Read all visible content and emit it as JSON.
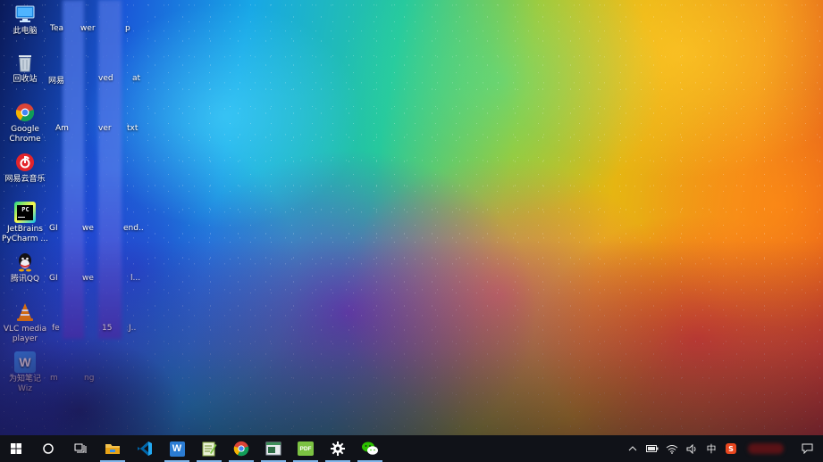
{
  "desktop_icons": [
    {
      "name": "this-pc",
      "label": "此电脑",
      "icon": "pc-icon"
    },
    {
      "name": "recycle-bin",
      "label": "回收站",
      "icon": "recycle-bin-icon"
    },
    {
      "name": "google-chrome",
      "label": "Google\nChrome",
      "icon": "chrome-icon"
    },
    {
      "name": "netease-music",
      "label": "网易云音乐",
      "icon": "netease-music-icon"
    },
    {
      "name": "pycharm",
      "label": "JetBrains\nPyCharm ...",
      "icon": "pycharm-icon"
    },
    {
      "name": "tencent-qq",
      "label": "腾讯QQ",
      "icon": "qq-icon"
    },
    {
      "name": "vlc",
      "label": "VLC media\nplayer",
      "icon": "vlc-icon"
    },
    {
      "name": "wiz-note",
      "label": "为知笔记\nWiz",
      "icon": "wiz-icon"
    }
  ],
  "obscured_fragments": [
    {
      "text": "Tea"
    },
    {
      "text": "wer"
    },
    {
      "text": "p"
    },
    {
      "text": "网易"
    },
    {
      "text": "ved"
    },
    {
      "text": "at"
    },
    {
      "text": "Am"
    },
    {
      "text": "ver"
    },
    {
      "text": "txt"
    },
    {
      "text": "GI"
    },
    {
      "text": "we"
    },
    {
      "text": "end.."
    },
    {
      "text": "GI"
    },
    {
      "text": "we"
    },
    {
      "text": "l..."
    },
    {
      "text": "fe"
    },
    {
      "text": "15"
    },
    {
      "text": "J.."
    },
    {
      "text": "m"
    },
    {
      "text": "ng"
    }
  ],
  "taskbar": {
    "start": "windows-start-icon",
    "search": "cortana-circle-icon",
    "task_view": "task-view-icon",
    "pinned": [
      {
        "name": "file-explorer",
        "icon": "folder-icon",
        "active": true
      },
      {
        "name": "vscode",
        "icon": "vscode-icon",
        "active": false
      },
      {
        "name": "word",
        "icon": "word-icon",
        "active": true
      },
      {
        "name": "notepad-plus",
        "icon": "notepad-icon",
        "active": true
      },
      {
        "name": "chrome",
        "icon": "chrome-icon",
        "active": true
      },
      {
        "name": "terminal",
        "icon": "terminal-icon",
        "active": true
      },
      {
        "name": "pdf",
        "icon": "pdf-icon",
        "active": true
      },
      {
        "name": "settings",
        "icon": "gear-icon",
        "active": true
      },
      {
        "name": "wechat",
        "icon": "wechat-icon",
        "active": true
      }
    ],
    "tray": {
      "ime": "中",
      "notification": "action-center-icon"
    }
  }
}
